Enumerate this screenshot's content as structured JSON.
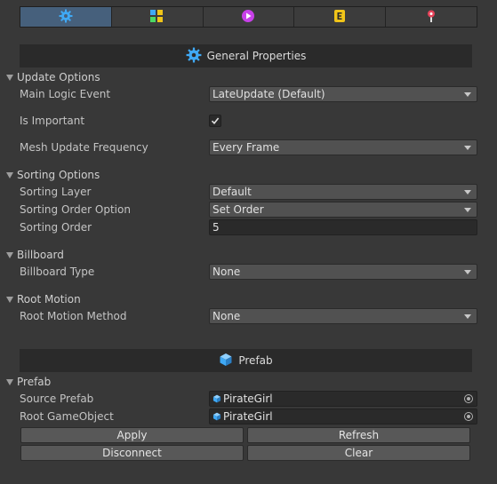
{
  "tabs": [
    {
      "icon": "gear-icon",
      "active": true
    },
    {
      "icon": "skin-grid-icon",
      "active": false
    },
    {
      "icon": "play-icon",
      "active": false
    },
    {
      "icon": "event-icon",
      "active": false
    },
    {
      "icon": "bone-pin-icon",
      "active": false
    }
  ],
  "general": {
    "title": "General Properties",
    "icon": "gear-icon"
  },
  "update_options": {
    "title": "Update Options",
    "main_logic_event_label": "Main Logic Event",
    "main_logic_event_value": "LateUpdate (Default)",
    "is_important_label": "Is Important",
    "is_important_checked": true,
    "mesh_update_label": "Mesh Update Frequency",
    "mesh_update_value": "Every Frame"
  },
  "sorting_options": {
    "title": "Sorting Options",
    "layer_label": "Sorting Layer",
    "layer_value": "Default",
    "order_option_label": "Sorting Order Option",
    "order_option_value": "Set Order",
    "order_label": "Sorting Order",
    "order_value": "5"
  },
  "billboard": {
    "title": "Billboard",
    "type_label": "Billboard Type",
    "type_value": "None"
  },
  "root_motion": {
    "title": "Root Motion",
    "method_label": "Root Motion Method",
    "method_value": "None"
  },
  "prefab_header": {
    "title": "Prefab",
    "icon": "cube-icon"
  },
  "prefab": {
    "title": "Prefab",
    "source_label": "Source Prefab",
    "source_value": "PirateGirl",
    "root_label": "Root GameObject",
    "root_value": "PirateGirl"
  },
  "buttons": {
    "apply": "Apply",
    "refresh": "Refresh",
    "disconnect": "Disconnect",
    "clear": "Clear"
  },
  "colors": {
    "background": "#383838",
    "tab_active": "#46607c",
    "accent_blue": "#3fa9f5"
  }
}
